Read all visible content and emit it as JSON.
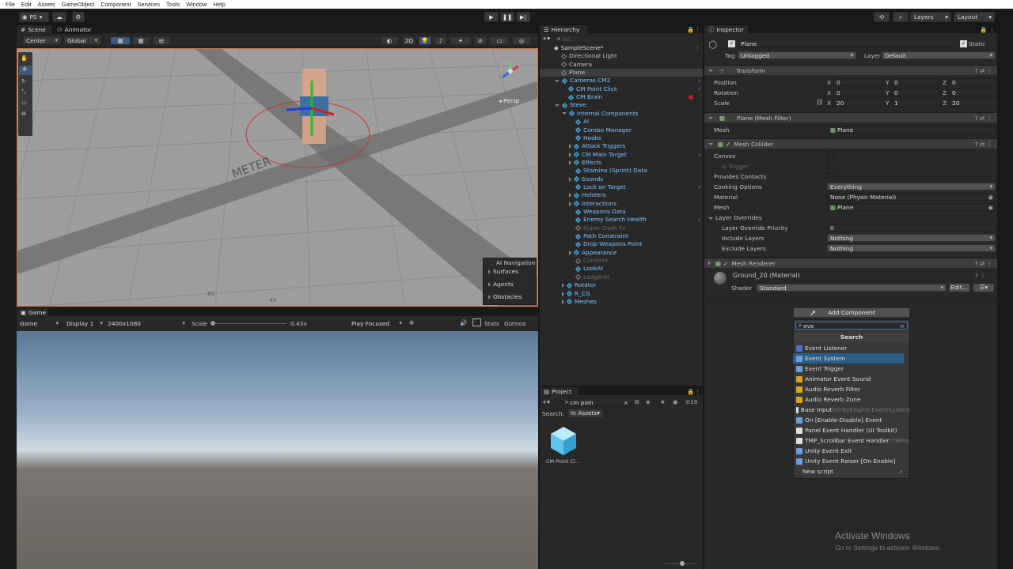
{
  "menu": [
    "File",
    "Edit",
    "Assets",
    "GameObject",
    "Component",
    "Services",
    "Tools",
    "Window",
    "Help"
  ],
  "toolbar": {
    "account": "PS",
    "layers": "Layers",
    "layout": "Layout"
  },
  "scene": {
    "tab_scene": "Scene",
    "tab_animator": "Animator",
    "pivot": "Center",
    "space": "Global",
    "mode_2d": "2D",
    "persp": "◂ Persp",
    "overlay_title": "AI Navigation",
    "overlay_items": [
      "Surfaces",
      "Agents",
      "Obstacles"
    ],
    "ground_text": "METER",
    "dial1": "60",
    "dial2": "45"
  },
  "game": {
    "tab": "Game",
    "mode": "Game",
    "display": "Display 1",
    "resolution": "2400x1080",
    "scale_label": "Scale",
    "scale_value": "0.43x",
    "play_focused": "Play Focused",
    "stats": "Stats",
    "gizmos": "Gizmos"
  },
  "hierarchy": {
    "tab": "Hierarchy",
    "search_placeholder": "All",
    "rows": [
      {
        "label": "SampleScene*",
        "indent": 0,
        "kind": "scene",
        "style": ""
      },
      {
        "label": "Directional Light",
        "indent": 1,
        "kind": "obj",
        "style": ""
      },
      {
        "label": "Camera",
        "indent": 1,
        "kind": "obj",
        "style": ""
      },
      {
        "label": "Plane",
        "indent": 1,
        "kind": "obj",
        "style": "sel"
      },
      {
        "label": "Cameras CM2",
        "indent": 1,
        "kind": "prefab",
        "style": "hl",
        "arrow": "d",
        "more": true
      },
      {
        "label": "CM Point Click",
        "indent": 2,
        "kind": "prefab",
        "style": "hl",
        "more": true
      },
      {
        "label": "CM Brain",
        "indent": 2,
        "kind": "prefab",
        "style": "hl",
        "dot": true
      },
      {
        "label": "Steve",
        "indent": 1,
        "kind": "prefab",
        "style": "hl",
        "arrow": "d"
      },
      {
        "label": "Internal Components",
        "indent": 2,
        "kind": "prefab",
        "style": "hl",
        "arrow": "d"
      },
      {
        "label": "AI",
        "indent": 3,
        "kind": "prefab",
        "style": "hl"
      },
      {
        "label": "Combo Manager",
        "indent": 3,
        "kind": "prefab",
        "style": "hl"
      },
      {
        "label": "Hooks",
        "indent": 3,
        "kind": "prefab",
        "style": "hl"
      },
      {
        "label": "Attack Triggers",
        "indent": 3,
        "kind": "prefab",
        "style": "hl",
        "arrow": "r"
      },
      {
        "label": "CM Main Target",
        "indent": 3,
        "kind": "prefab",
        "style": "hl",
        "arrow": "r",
        "more": true
      },
      {
        "label": "Effects",
        "indent": 3,
        "kind": "prefab",
        "style": "hl",
        "arrow": "r"
      },
      {
        "label": "Stamina (Sprint) Data",
        "indent": 3,
        "kind": "prefab",
        "style": "hl"
      },
      {
        "label": "Sounds",
        "indent": 3,
        "kind": "prefab",
        "style": "hl",
        "arrow": "r"
      },
      {
        "label": "Lock on Target",
        "indent": 3,
        "kind": "prefab",
        "style": "hl",
        "more": true
      },
      {
        "label": "Holsters",
        "indent": 3,
        "kind": "prefab",
        "style": "hl",
        "arrow": "r"
      },
      {
        "label": "Interactions",
        "indent": 3,
        "kind": "prefab",
        "style": "hl",
        "arrow": "r"
      },
      {
        "label": "Weapons Data",
        "indent": 3,
        "kind": "prefab",
        "style": "hl"
      },
      {
        "label": "Enemy Search Health",
        "indent": 3,
        "kind": "prefab",
        "style": "hl",
        "more": true
      },
      {
        "label": "Super Dash Fx",
        "indent": 3,
        "kind": "prefab",
        "style": "ghost"
      },
      {
        "label": "Path Constraint",
        "indent": 3,
        "kind": "prefab",
        "style": "hl"
      },
      {
        "label": "Drop Weapons Point",
        "indent": 3,
        "kind": "prefab",
        "style": "hl"
      },
      {
        "label": "Appearance",
        "indent": 3,
        "kind": "prefab",
        "style": "hl",
        "arrow": "r"
      },
      {
        "label": "ClimbHit",
        "indent": 3,
        "kind": "prefab",
        "style": "ghost"
      },
      {
        "label": "LookAt",
        "indent": 3,
        "kind": "prefab",
        "style": "hl"
      },
      {
        "label": "LedgeHit",
        "indent": 3,
        "kind": "prefab",
        "style": "ghost"
      },
      {
        "label": "Rotator",
        "indent": 2,
        "kind": "prefab",
        "style": "hl",
        "arrow": "r"
      },
      {
        "label": "R_CG",
        "indent": 2,
        "kind": "prefab",
        "style": "hl",
        "arrow": "r"
      },
      {
        "label": "Meshes",
        "indent": 2,
        "kind": "prefab",
        "style": "hl",
        "arrow": "r"
      }
    ]
  },
  "project": {
    "tab": "Project",
    "search_value": "cm poin",
    "search_label": "Search:",
    "scope": "In Assets",
    "count": "18",
    "asset_label": "CM Point Cl..."
  },
  "inspector": {
    "tab": "Inspector",
    "object_name": "Plane",
    "static_label": "Static",
    "tag_label": "Tag",
    "tag_value": "Untagged",
    "layer_label": "Layer",
    "layer_value": "Default",
    "transform": {
      "title": "Transform",
      "position": {
        "label": "Position",
        "x": "0",
        "y": "0",
        "z": "0"
      },
      "rotation": {
        "label": "Rotation",
        "x": "0",
        "y": "0",
        "z": "0"
      },
      "scale": {
        "label": "Scale",
        "x": "20",
        "y": "1",
        "z": "20"
      }
    },
    "mesh_filter": {
      "title": "Plane (Mesh Filter)",
      "mesh_label": "Mesh",
      "mesh_value": "Plane"
    },
    "mesh_collider": {
      "title": "Mesh Collider",
      "convex": "Convex",
      "is_trigger": "Is Trigger",
      "provides_contacts": "Provides Contacts",
      "cooking_label": "Cooking Options",
      "cooking_value": "Everything",
      "material_label": "Material",
      "material_value": "None (Physic Material)",
      "mesh_label": "Mesh",
      "mesh_value": "Plane",
      "overrides": "Layer Overrides",
      "priority_label": "Layer Override Priority",
      "priority_value": "0",
      "include_label": "Include Layers",
      "include_value": "Nothing",
      "exclude_label": "Exclude Layers",
      "exclude_value": "Nothing"
    },
    "mesh_renderer": {
      "title": "Mesh Renderer"
    },
    "material": {
      "name": "Ground_20 (Material)",
      "shader_label": "Shader",
      "shader_value": "Standard",
      "edit": "Edit..."
    },
    "add_component": "Add Component",
    "search_value": "eve",
    "search_header": "Search",
    "results": [
      {
        "label": "Event Listener",
        "suffix": "",
        "icon": "#4a6fd0"
      },
      {
        "label": "Event System",
        "suffix": "",
        "icon": "#6aa0e0",
        "selected": true
      },
      {
        "label": "Event Trigger",
        "suffix": "",
        "icon": "#6aa0e0"
      },
      {
        "label": "Animator Event Sound",
        "suffix": "",
        "icon": "#d9a420"
      },
      {
        "label": "Audio Reverb Filter",
        "suffix": "",
        "icon": "#d9a420"
      },
      {
        "label": "Audio Reverb Zone",
        "suffix": "",
        "icon": "#d9a420"
      },
      {
        "label": "Base Input",
        "suffix": " (UnityEngine.EventSystem",
        "icon": "#e0e0e0"
      },
      {
        "label": "On [Enable-Disable] Event",
        "suffix": "",
        "icon": "#6aa0e0"
      },
      {
        "label": "Panel Event Handler (UI Toolkit)",
        "suffix": "",
        "icon": "#e0e0e0"
      },
      {
        "label": "TMP_Scrollbar Event Handler",
        "suffix": " (TMPro",
        "icon": "#e0e0e0"
      },
      {
        "label": "Unity Event Exit",
        "suffix": "",
        "icon": "#6aa0e0"
      },
      {
        "label": "Unity Event Raiser [On Enable]",
        "suffix": "",
        "icon": "#6aa0e0"
      },
      {
        "label": "New script",
        "suffix": "",
        "icon": ""
      }
    ]
  },
  "watermark": {
    "title": "Activate Windows",
    "subtitle": "Go to Settings to activate Windows."
  },
  "colors": {
    "accent": "#3a72b0",
    "highlight": "#7ec5ff",
    "selected_row": "#2c5d87",
    "orange_border": "#e8702a"
  }
}
